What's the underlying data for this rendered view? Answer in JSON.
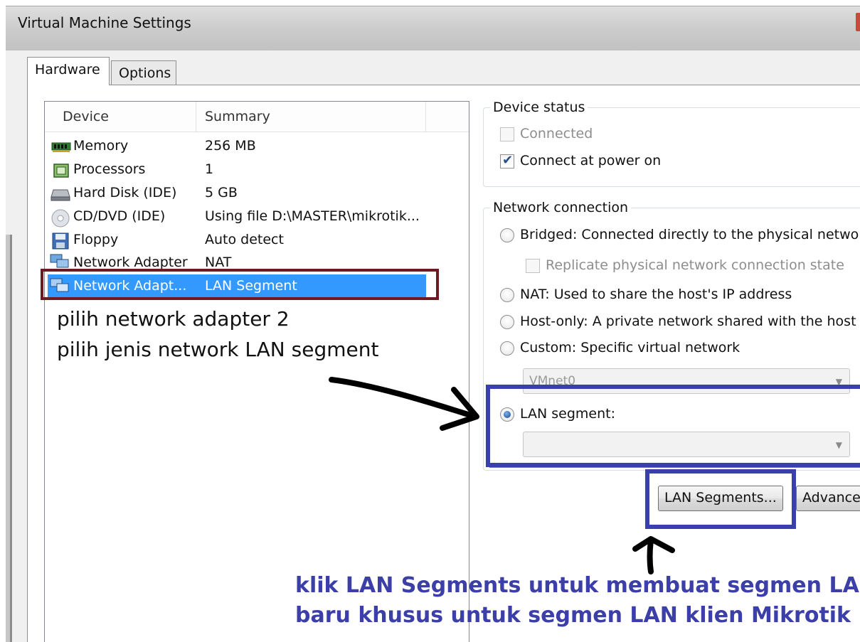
{
  "window": {
    "title": "Virtual Machine Settings"
  },
  "tabs": [
    {
      "label": "Hardware",
      "active": true
    },
    {
      "label": "Options",
      "active": false
    }
  ],
  "device_list": {
    "columns": [
      "Device",
      "Summary"
    ],
    "rows": [
      {
        "icon": "memory-icon",
        "device": "Memory",
        "summary": "256 MB"
      },
      {
        "icon": "processor-icon",
        "device": "Processors",
        "summary": "1"
      },
      {
        "icon": "hard-disk-icon",
        "device": "Hard Disk (IDE)",
        "summary": "5 GB"
      },
      {
        "icon": "cd-dvd-icon",
        "device": "CD/DVD (IDE)",
        "summary": "Using file D:\\MASTER\\mikrotik..."
      },
      {
        "icon": "floppy-icon",
        "device": "Floppy",
        "summary": "Auto detect"
      },
      {
        "icon": "network-adapter-icon",
        "device": "Network Adapter",
        "summary": "NAT"
      },
      {
        "icon": "network-adapter-icon",
        "device": "Network Adapt...",
        "summary": "LAN Segment",
        "selected": true
      }
    ]
  },
  "annotations": {
    "left_line1": "pilih network adapter 2",
    "left_line2": "pilih jenis network LAN segment",
    "bottom_line1": "klik LAN Segments untuk membuat segmen LAN",
    "bottom_line2": "baru khusus untuk segmen LAN klien Mikrotik",
    "colors": {
      "maroon_box": "#6e1a22",
      "blue_box": "#3a3fae",
      "blue_text": "#3c3fa8"
    }
  },
  "device_status": {
    "legend": "Device status",
    "connected": {
      "label": "Connected",
      "checked": false,
      "enabled": false
    },
    "connect_at_power_on": {
      "label": "Connect at power on",
      "checked": true,
      "enabled": true
    }
  },
  "network_connection": {
    "legend": "Network connection",
    "bridged": {
      "label": "Bridged: Connected directly to the physical network",
      "selected": false
    },
    "replicate": {
      "label": "Replicate physical network connection state",
      "checked": false,
      "enabled": false
    },
    "nat": {
      "label": "NAT: Used to share the host's IP address",
      "selected": false
    },
    "host_only": {
      "label": "Host-only: A private network shared with the host",
      "selected": false
    },
    "custom": {
      "label": "Custom: Specific virtual network",
      "selected": false
    },
    "custom_select_value": "VMnet0",
    "lan_segment": {
      "label": "LAN segment:",
      "selected": true
    },
    "lan_segment_select_value": ""
  },
  "buttons": {
    "lan_segments": "LAN Segments...",
    "advanced": "Advance"
  }
}
